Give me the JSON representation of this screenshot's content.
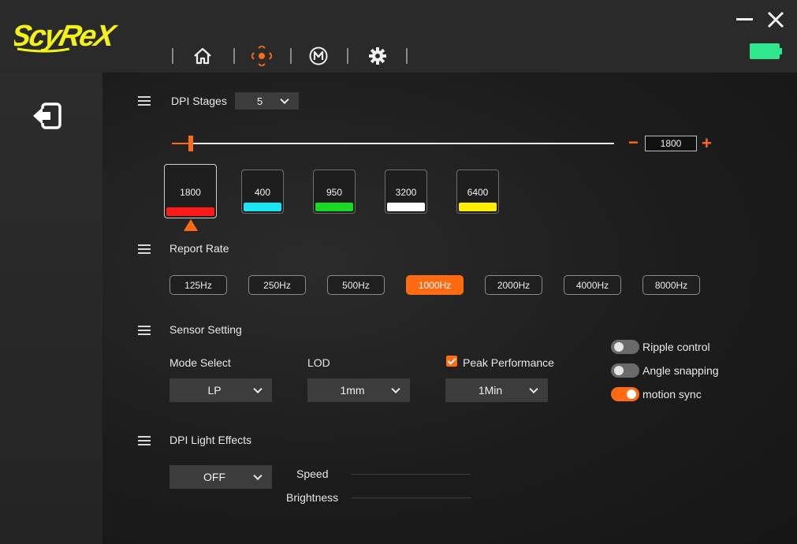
{
  "app": {
    "logo_text": "ScyRex",
    "accent_color": "#ff6a13",
    "battery_color": "#2ee88e"
  },
  "nav": {
    "items": [
      {
        "name": "home",
        "icon": "home-icon",
        "active": false
      },
      {
        "name": "dpi",
        "icon": "crosshair-icon",
        "active": true
      },
      {
        "name": "macro",
        "icon": "macro-m-icon",
        "active": false
      },
      {
        "name": "settings",
        "icon": "gear-icon",
        "active": false
      }
    ]
  },
  "window": {
    "minimize": "minimize-icon",
    "close": "close-icon"
  },
  "dpi": {
    "stages_label": "DPI Stages",
    "stages_value": "5",
    "current_value": "1800",
    "slider_fraction": 0.043,
    "minus": "−",
    "plus": "+",
    "stages": [
      {
        "value": "1800",
        "color": "#ff1a1a",
        "active": true
      },
      {
        "value": "400",
        "color": "#18e6f2",
        "active": false
      },
      {
        "value": "950",
        "color": "#19d925",
        "active": false
      },
      {
        "value": "3200",
        "color": "#ffffff",
        "active": false
      },
      {
        "value": "6400",
        "color": "#ffee00",
        "active": false
      }
    ]
  },
  "report_rate": {
    "label": "Report Rate",
    "options": [
      "125Hz",
      "250Hz",
      "500Hz",
      "1000Hz",
      "2000Hz",
      "4000Hz",
      "8000Hz"
    ],
    "selected": "1000Hz"
  },
  "sensor": {
    "label": "Sensor Setting",
    "mode_label": "Mode Select",
    "mode_value": "LP",
    "lod_label": "LOD",
    "lod_value": "1mm",
    "peak_label": "Peak Performance",
    "peak_checked": true,
    "peak_value": "1Min",
    "toggles": [
      {
        "label": "Ripple control",
        "on": false
      },
      {
        "label": "Angle snapping",
        "on": false
      },
      {
        "label": "motion sync",
        "on": true
      }
    ]
  },
  "light": {
    "label": "DPI Light Effects",
    "mode_value": "OFF",
    "speed_label": "Speed",
    "brightness_label": "Brightness"
  }
}
